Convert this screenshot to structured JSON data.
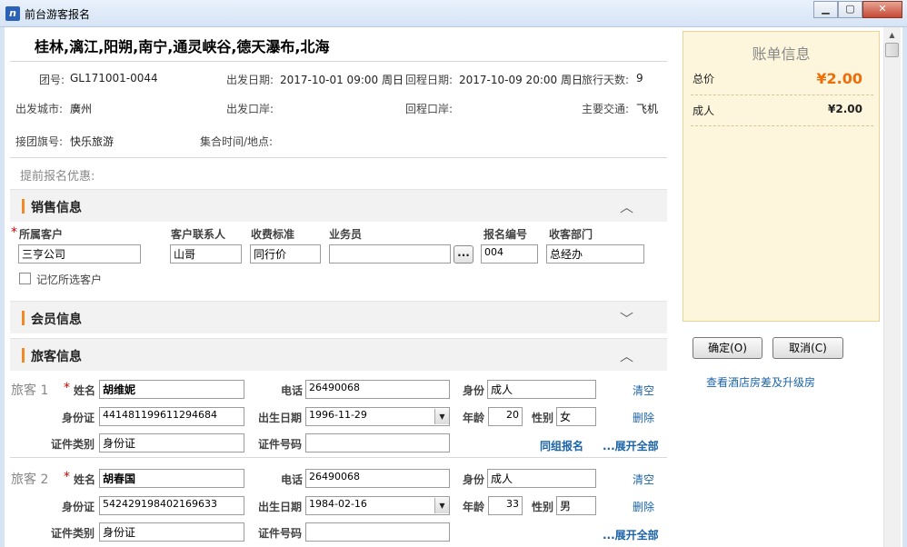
{
  "window": {
    "title": "前台游客报名",
    "icon": "app-icon",
    "min": "▁",
    "max": "▢",
    "close": "✕"
  },
  "tour": {
    "route": "桂林,漓江,阳朔,南宁,通灵峡谷,德天瀑布,北海",
    "group_no_label": "团号:",
    "group_no": "GL171001-0044",
    "depart_date_label": "出发日期:",
    "depart_date": "2017-10-01 09:00 周日",
    "return_date_label": "回程日期:",
    "return_date": "2017-10-09 20:00 周日",
    "days_label": "旅行天数:",
    "days": "9",
    "depart_city_label": "出发城市:",
    "depart_city": "廣州",
    "depart_port_label": "出发口岸:",
    "return_port_label": "回程口岸:",
    "transport_label": "主要交通:",
    "transport": "飞机",
    "flag_label": "接团旗号:",
    "flag": "快乐旅游",
    "meet_label": "集合时间/地点:",
    "promo_label": "提前报名优惠:"
  },
  "sales": {
    "title": "销售信息",
    "toggle": "︿",
    "customer_label": "所属客户",
    "customer": "三亨公司",
    "contact_label": "客户联系人",
    "contact": "山哥",
    "fee_label": "收费标准",
    "fee": "同行价",
    "sales_label": "业务员",
    "sales": "",
    "browse": "...",
    "reg_no_label": "报名编号",
    "reg_no": "004",
    "dept_label": "收客部门",
    "dept": "总经办",
    "remember_label": "记忆所选客户"
  },
  "member": {
    "title": "会员信息",
    "toggle": "﹀"
  },
  "travelers_section": {
    "title": "旅客信息",
    "toggle": "︿"
  },
  "labels": {
    "name": "姓名",
    "phone": "电话",
    "identity": "身份",
    "id_card": "身份证",
    "birth": "出生日期",
    "age": "年龄",
    "gender": "性别",
    "cert_type": "证件类别",
    "cert_no": "证件号码",
    "clear": "清空",
    "delete": "删除",
    "same_group": "同组报名",
    "expand": "...展开全部",
    "req": "*"
  },
  "travelers": [
    {
      "seq": "旅客 1",
      "name": "胡维妮",
      "phone": "26490068",
      "identity": "成人",
      "id_card": "441481199611294684",
      "birth": "1996-11-29",
      "age": "20",
      "gender": "女",
      "cert_type": "身份证",
      "cert_no": ""
    },
    {
      "seq": "旅客 2",
      "name": "胡春国",
      "phone": "26490068",
      "identity": "成人",
      "id_card": "542429198402169633",
      "birth": "1984-02-16",
      "age": "33",
      "gender": "男",
      "cert_type": "身份证",
      "cert_no": ""
    }
  ],
  "bill": {
    "title": "账单信息",
    "total_label": "总价",
    "total": "¥2.00",
    "adult_label": "成人",
    "adult": "¥2.00"
  },
  "actions": {
    "ok": "确定(O)",
    "cancel": "取消(C)",
    "hotel_link": "查看酒店房差及升级房"
  }
}
